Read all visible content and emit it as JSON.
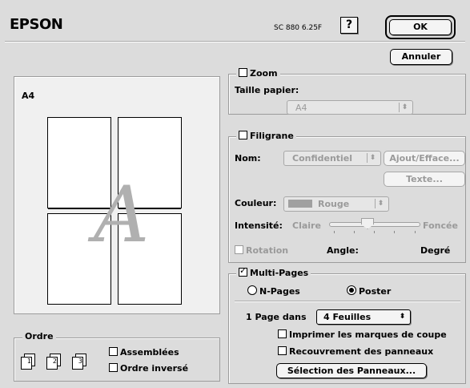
{
  "header": {
    "brand": "EPSON",
    "model": "SC 880 6.25F",
    "help_label": "?"
  },
  "buttons": {
    "ok": "OK",
    "cancel": "Annuler"
  },
  "preview": {
    "paper_label": "A4",
    "watermark_letter": "A"
  },
  "order": {
    "title": "Ordre",
    "collated": "Assemblées",
    "reverse": "Ordre inversé",
    "collated_checked": false,
    "reverse_checked": false,
    "icons": [
      {
        "numbers": [
          "1",
          "1"
        ]
      },
      {
        "numbers": [
          "2",
          "2"
        ]
      },
      {
        "numbers": [
          "3",
          "3"
        ]
      }
    ]
  },
  "zoom": {
    "label": "Zoom",
    "checked": false,
    "paper_size_label": "Taille papier:",
    "paper_size_value": "A4"
  },
  "watermark": {
    "label": "Filigrane",
    "checked": false,
    "name_label": "Nom:",
    "name_value": "Confidentiel",
    "add_remove_button": "Ajout/Efface...",
    "text_button": "Texte...",
    "color_label": "Couleur:",
    "color_value": "Rouge",
    "color_swatch": "#a0a0a0",
    "intensity_label": "Intensité:",
    "intensity_low": "Claire",
    "intensity_high": "Foncée",
    "intensity_level": 0.4,
    "rotation_label": "Rotation",
    "angle_label": "Angle:",
    "degree_label": "Degré"
  },
  "multipage": {
    "label": "Multi-Pages",
    "checked": true,
    "npages_label": "N-Pages",
    "poster_label": "Poster",
    "selected": "poster",
    "page_in_label": "1 Page dans",
    "sheets_value": "4 Feuilles",
    "crop_marks_label": "Imprimer les marques de coupe",
    "crop_marks_checked": false,
    "overlap_label": "Recouvrement des panneaux",
    "overlap_checked": false,
    "select_panels_button": "Sélection des Panneaux..."
  }
}
